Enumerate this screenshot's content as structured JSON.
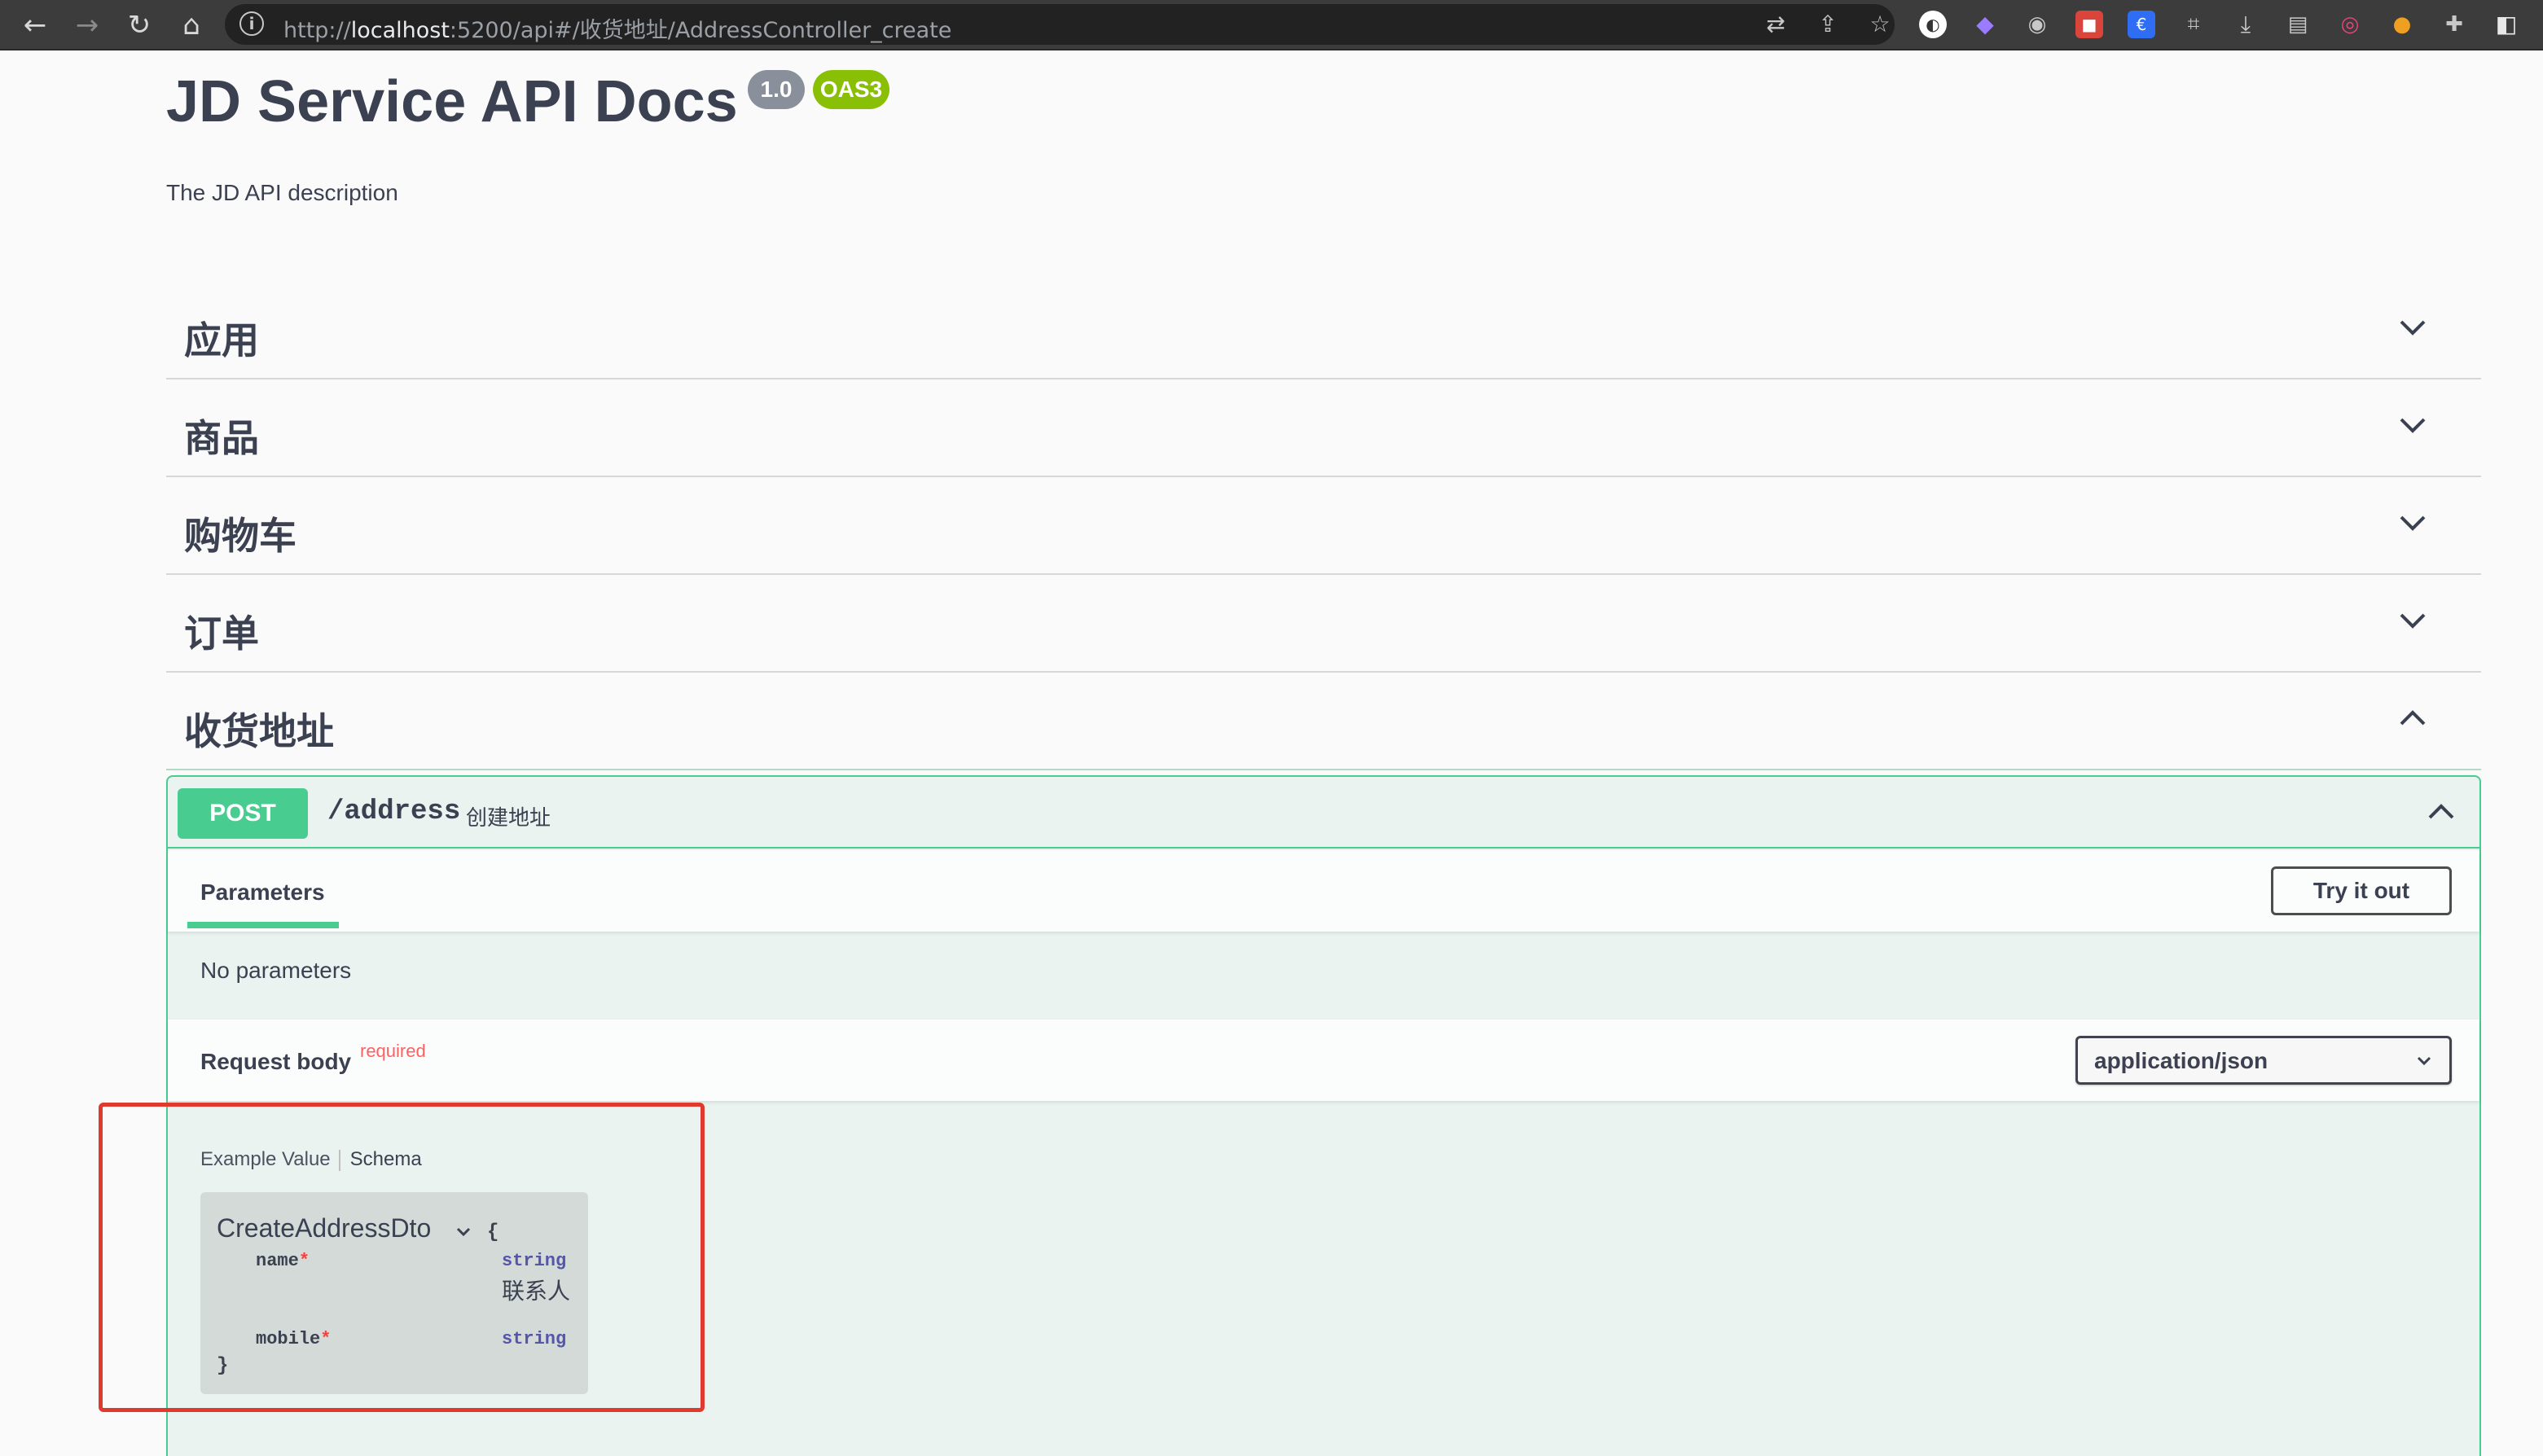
{
  "browser": {
    "url_prefix": "http://",
    "url_host": "localhost",
    "url_rest": ":5200/api#/收货地址/AddressController_create"
  },
  "page": {
    "title": "JD Service API Docs",
    "version_badge": "1.0",
    "oas_badge": "OAS3",
    "description": "The JD API description"
  },
  "tags": [
    {
      "name": "应用",
      "expanded": false
    },
    {
      "name": "商品",
      "expanded": false
    },
    {
      "name": "购物车",
      "expanded": false
    },
    {
      "name": "订单",
      "expanded": false
    },
    {
      "name": "收货地址",
      "expanded": true
    }
  ],
  "operation": {
    "method": "POST",
    "path": "/address",
    "summary": "创建地址",
    "parameters_tab": "Parameters",
    "try_button": "Try it out",
    "no_params": "No parameters",
    "request_body_label": "Request body",
    "required_label": "required",
    "content_type": "application/json",
    "example_tab": "Example Value",
    "schema_tab": "Schema",
    "model": {
      "name": "CreateAddressDto",
      "open_brace": "{",
      "close_brace": "}",
      "properties": [
        {
          "name": "name",
          "required_mark": "*",
          "type": "string",
          "description": "联系人"
        },
        {
          "name": "mobile",
          "required_mark": "*",
          "type": "string",
          "description": ""
        }
      ]
    }
  },
  "colors": {
    "post_accent": "#49cc90",
    "highlight_box": "#e03a2e"
  }
}
